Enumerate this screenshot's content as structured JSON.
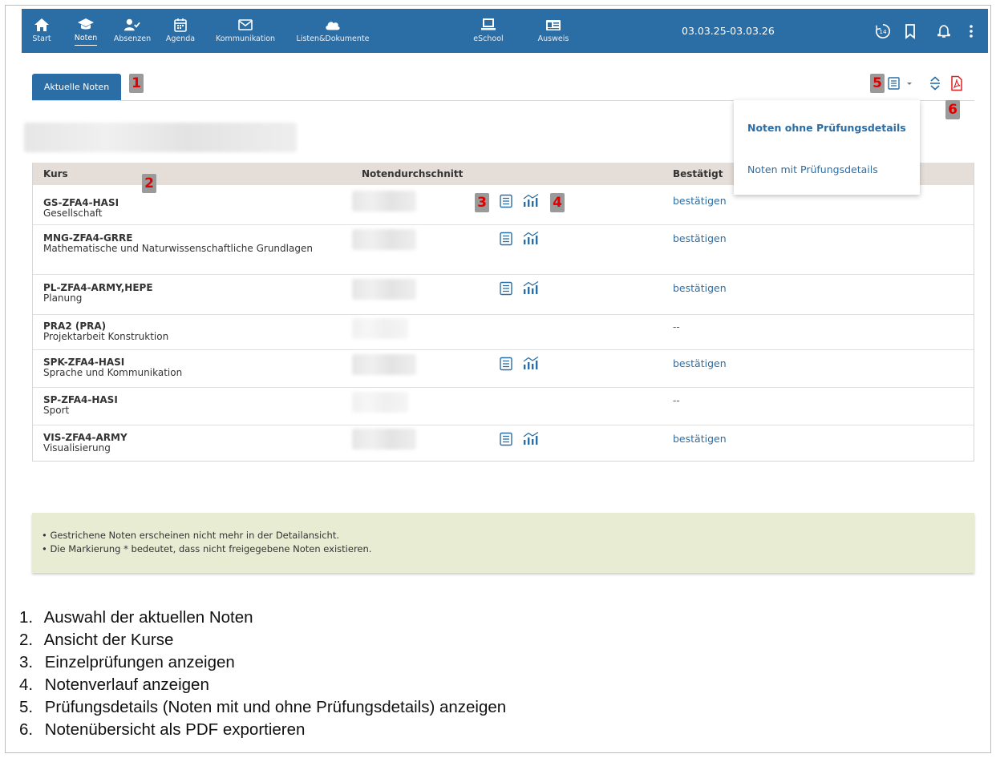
{
  "nav": {
    "items": [
      {
        "label": "Start",
        "icon": "home-icon"
      },
      {
        "label": "Noten",
        "icon": "graduation-cap-icon",
        "active": true
      },
      {
        "label": "Absenzen",
        "icon": "user-check-icon"
      },
      {
        "label": "Agenda",
        "icon": "calendar-icon"
      },
      {
        "label": "Kommunikation",
        "icon": "envelope-icon"
      },
      {
        "label": "Listen&Dokumente",
        "icon": "cloud-icon"
      },
      {
        "label": "eSchool",
        "icon": "laptop-icon"
      },
      {
        "label": "Ausweis",
        "icon": "id-card-icon"
      }
    ],
    "date_range": "03.03.25-03.03.26",
    "timer_badge": "14",
    "right_icons": [
      "timer-icon",
      "bookmark-icon",
      "bell-icon",
      "more-vertical-icon"
    ]
  },
  "tab": {
    "label": "Aktuelle Noten"
  },
  "markers": {
    "m1": "1",
    "m2": "2",
    "m3": "3",
    "m4": "4",
    "m5": "5",
    "m6": "6"
  },
  "table": {
    "headers": {
      "course": "Kurs",
      "average": "Notendurchschnitt",
      "confirmed": "Bestätigt"
    },
    "rows": [
      {
        "code": "GS-ZFA4-HASI",
        "name": "Gesellschaft",
        "confirm": "bestätigen",
        "icons": true
      },
      {
        "code": "MNG-ZFA4-GRRE",
        "name": "Mathematische und Naturwissenschaftliche Grundlagen",
        "confirm": "bestätigen",
        "icons": true
      },
      {
        "code": "PL-ZFA4-ARMY,HEPE",
        "name": "Planung",
        "confirm": "bestätigen",
        "icons": true
      },
      {
        "code": "PRA2 (PRA)",
        "name": "Projektarbeit Konstruktion",
        "confirm": "--",
        "icons": false
      },
      {
        "code": "SPK-ZFA4-HASI",
        "name": "Sprache und Kommunikation",
        "confirm": "bestätigen",
        "icons": true
      },
      {
        "code": "SP-ZFA4-HASI",
        "name": "Sport",
        "confirm": "--",
        "icons": false
      },
      {
        "code": "VIS-ZFA4-ARMY",
        "name": "Visualisierung",
        "confirm": "bestätigen",
        "icons": true
      }
    ]
  },
  "dropdown": {
    "items": [
      "Noten ohne Prüfungsdetails",
      "Noten mit Prüfungsdetails"
    ]
  },
  "notes": [
    "• Gestrichene Noten erscheinen nicht mehr in der Detailansicht.",
    "• Die Markierung * bedeutet, dass nicht freigegebene Noten existieren."
  ],
  "legend": [
    {
      "num": "1.",
      "text": "Auswahl der aktuellen Noten"
    },
    {
      "num": "2.",
      "text": "Ansicht der Kurse"
    },
    {
      "num": "3.",
      "text": "Einzelprüfungen anzeigen"
    },
    {
      "num": "4.",
      "text": "Notenverlauf anzeigen"
    },
    {
      "num": "5.",
      "text": "Prüfungsdetails (Noten mit und ohne Prüfungsdetails) anzeigen"
    },
    {
      "num": "6.",
      "text": "Notenübersicht als PDF exportieren"
    }
  ],
  "colors": {
    "brand": "#2b6ea5",
    "header_row": "#e5ddd8",
    "notes_bg": "#e7ecd3",
    "marker_text": "#e00000"
  }
}
